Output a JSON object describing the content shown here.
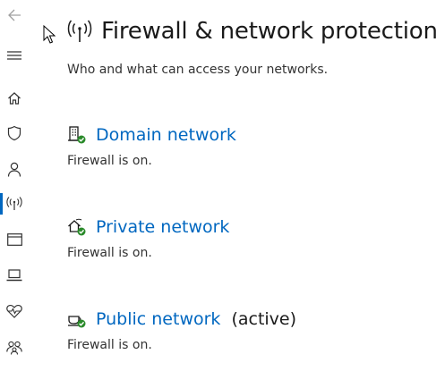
{
  "nav": {
    "items": [
      {
        "icon": "back-arrow-icon"
      },
      {
        "icon": "hamburger-menu-icon"
      },
      {
        "icon": "home-icon"
      },
      {
        "icon": "shield-icon"
      },
      {
        "icon": "person-icon"
      },
      {
        "icon": "network-antenna-icon",
        "selected": true
      },
      {
        "icon": "app-browser-icon"
      },
      {
        "icon": "laptop-icon"
      },
      {
        "icon": "heart-pulse-icon"
      },
      {
        "icon": "family-icon"
      }
    ],
    "accent": "#0067c0"
  },
  "page": {
    "title": "Firewall & network protection",
    "subtitle": "Who and what can access your networks."
  },
  "networks": [
    {
      "name": "Domain network",
      "status": "Firewall is on.",
      "active_label": ""
    },
    {
      "name": "Private network",
      "status": "Firewall is on.",
      "active_label": ""
    },
    {
      "name": "Public network",
      "status": "Firewall is on.",
      "active_label": "(active)"
    }
  ],
  "colors": {
    "link": "#0067c0",
    "ok_badge": "#2a8a2a",
    "text": "#1a1a1a"
  }
}
